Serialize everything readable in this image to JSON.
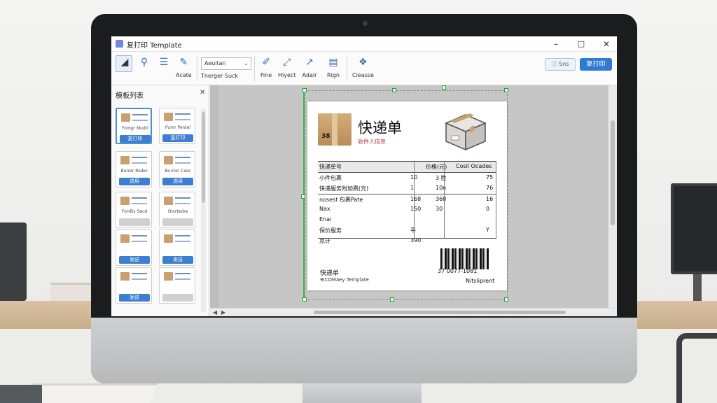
{
  "window": {
    "title": "复打印 Template"
  },
  "toolbar": {
    "tools": [
      {
        "icon": "select-arrow-icon",
        "label": ""
      },
      {
        "icon": "zoom-icon",
        "label": ""
      },
      {
        "icon": "list-icon",
        "label": ""
      },
      {
        "icon": "eraser-icon",
        "label": "Acate"
      },
      {
        "icon": "font-icon",
        "label": "Tnerger Suck"
      },
      {
        "icon": "pen-icon",
        "label": "Fine"
      },
      {
        "icon": "shape-icon",
        "label": "Hiyect"
      },
      {
        "icon": "arrow-icon",
        "label": "Adair"
      },
      {
        "icon": "page-icon",
        "label": "Rign"
      },
      {
        "icon": "palette-icon",
        "label": "Cieasse"
      }
    ],
    "font_select": "Aeuitan",
    "help_label": "Sns",
    "print_label": "复打印"
  },
  "panel": {
    "title": "模板列表",
    "cards": [
      {
        "text": "Fomgr Mudir",
        "button": "复打印",
        "active": true,
        "gray": false
      },
      {
        "text": "Pumr Pentel",
        "button": "复打印",
        "active": false,
        "gray": false
      },
      {
        "text": "Barrer Rsdec",
        "button": "选用",
        "active": false,
        "gray": false
      },
      {
        "text": "Burrier Cass",
        "button": "选用",
        "active": false,
        "gray": false
      },
      {
        "text": "Fordlis Secd",
        "button": "",
        "active": false,
        "gray": true
      },
      {
        "text": "Oinrtedre",
        "button": "",
        "active": false,
        "gray": true
      },
      {
        "text": "",
        "button": "发送",
        "active": false,
        "gray": false
      },
      {
        "text": "",
        "button": "发送",
        "active": false,
        "gray": false
      },
      {
        "text": "",
        "button": "发送",
        "active": false,
        "gray": false
      },
      {
        "text": "",
        "button": "",
        "active": false,
        "gray": true
      }
    ]
  },
  "label": {
    "box_number": "38",
    "title": "快递单",
    "subtitle": "收件人信息",
    "table": {
      "headers": [
        "快递单号",
        "价格(元)",
        "Cosil Ocades"
      ],
      "rows": [
        [
          "小件包裹",
          "10",
          "3 胜",
          "75"
        ],
        [
          "快递服务附加费(元)",
          "1",
          "10n",
          "76"
        ],
        [
          "nosest 包裹Pate",
          "168",
          "360",
          "16"
        ],
        [
          "Nax",
          "150",
          "30",
          "0"
        ],
        [
          "Enai",
          "",
          "",
          ""
        ],
        [
          "保价服务",
          "平",
          "",
          "Y"
        ],
        [
          "总计",
          "390",
          "",
          ""
        ]
      ]
    },
    "barcode_number": "37 0077-1081",
    "footer_title": "快递单",
    "footer_note": "9ICOMaey Template",
    "footer_right": "Nitsliprent"
  },
  "colors": {
    "accent": "#2f7bd3",
    "selection": "#3dbb4a",
    "subtitle_red": "#c2333a"
  }
}
